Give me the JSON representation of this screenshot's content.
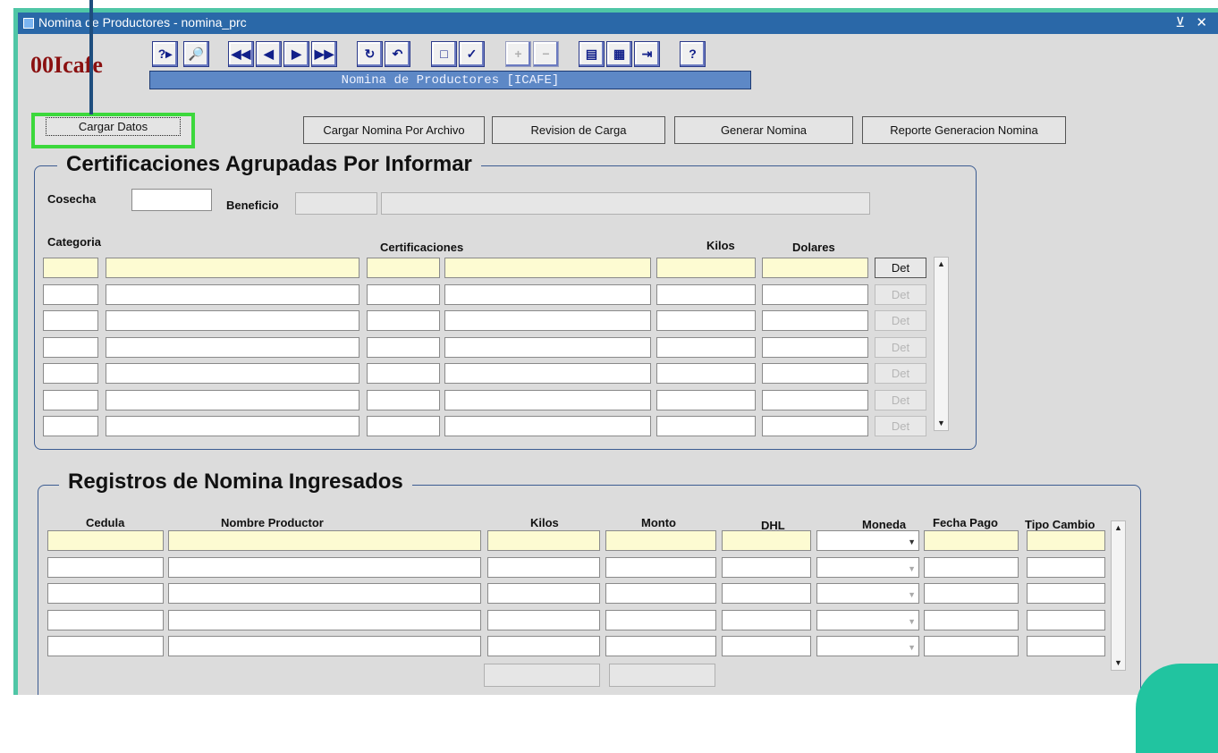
{
  "window": {
    "title": "Nomina de Productores - nomina_prc",
    "controls": "⊻ ✕"
  },
  "logo": "00Icafe",
  "toolbar": {
    "buttons": [
      {
        "name": "query-help-icon",
        "glyph": "?▸"
      },
      {
        "name": "query-icon",
        "glyph": "🔎"
      },
      {
        "name": "first-record-icon",
        "glyph": "◀◀"
      },
      {
        "name": "previous-record-icon",
        "glyph": "◀"
      },
      {
        "name": "next-record-icon",
        "glyph": "▶"
      },
      {
        "name": "last-record-icon",
        "glyph": "▶▶"
      },
      {
        "name": "refresh-icon",
        "glyph": "↻"
      },
      {
        "name": "undo-icon",
        "glyph": "↶"
      },
      {
        "name": "new-page-icon",
        "glyph": "□"
      },
      {
        "name": "save-icon",
        "glyph": "✓"
      },
      {
        "name": "insert-record-icon",
        "glyph": "+"
      },
      {
        "name": "delete-record-icon",
        "glyph": "−"
      },
      {
        "name": "notebook-icon",
        "glyph": "▤"
      },
      {
        "name": "print-icon",
        "glyph": "▦"
      },
      {
        "name": "exit-icon",
        "glyph": "⇥"
      },
      {
        "name": "help-icon",
        "glyph": "?"
      }
    ],
    "banner": "Nomina de Productores [ICAFE]"
  },
  "actions": {
    "cargar_datos": "Cargar Datos",
    "cargar_nomina_archivo": "Cargar Nomina Por Archivo",
    "revision_carga": "Revision de Carga",
    "generar_nomina": "Generar Nomina",
    "reporte_generacion": "Reporte  Generacion Nomina"
  },
  "certificaciones": {
    "legend": "Certificaciones Agrupadas Por Informar",
    "cosecha_label": "Cosecha",
    "beneficio_label": "Beneficio",
    "col_categoria": "Categoria",
    "col_certificaciones": "Certificaciones",
    "col_kilos": "Kilos",
    "col_dolares": "Dolares",
    "det_label": "Det",
    "row_count": 7
  },
  "registros": {
    "legend": "Registros de Nomina Ingresados",
    "col_cedula": "Cedula",
    "col_nombre": "Nombre Productor",
    "col_kilos": "Kilos",
    "col_monto": "Monto",
    "col_dhl": "DHL",
    "col_moneda": "Moneda",
    "col_fecha_pago": "Fecha Pago",
    "col_tipo_cambio": "Tipo Cambio",
    "row_count": 5
  }
}
